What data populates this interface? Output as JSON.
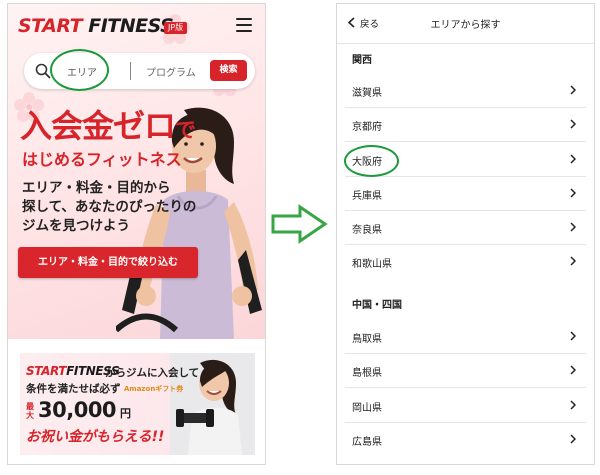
{
  "left_screen": {
    "logo": {
      "part1": "START",
      "part2": " FITNESS"
    },
    "jp_badge": "JP版",
    "search": {
      "area": "エリア",
      "program": "プログラム",
      "button": "検索"
    },
    "hero": {
      "headline": "入会金ゼロ",
      "headline_suffix": "で",
      "subheadline": "はじめるフィットネス",
      "body_lines": [
        "エリア・料金・目的から",
        "探して、あなたのぴったりの",
        "ジムを見つけよう"
      ],
      "cta_button": "エリア・料金・目的で絞り込む"
    },
    "promo": {
      "logo_part1": "START",
      "logo_part2": "FITNESS",
      "line1": "からジムに入会して",
      "line2": "条件を満たせば必ず",
      "amazon_label": "Amazonギフト券",
      "max_label": "最大",
      "amount": "30,000",
      "amount_unit": "円",
      "line3": "お祝い金がもらえる!!"
    },
    "colors": {
      "brand_red": "#d7232a",
      "annotation_green": "#1a9a3a"
    }
  },
  "right_screen": {
    "back_label": "戻る",
    "title": "エリアから探す",
    "sections": [
      {
        "header": "関西",
        "items": [
          "滋賀県",
          "京都府",
          "大阪府",
          "兵庫県",
          "奈良県",
          "和歌山県"
        ]
      },
      {
        "header": "中国・四国",
        "items": [
          "鳥取県",
          "島根県",
          "岡山県",
          "広島県"
        ]
      }
    ]
  },
  "icons": {
    "search": "search-icon",
    "menu": "hamburger-menu-icon",
    "back": "chevron-left-icon",
    "row": "chevron-right-icon",
    "arrow": "right-arrow-icon"
  }
}
